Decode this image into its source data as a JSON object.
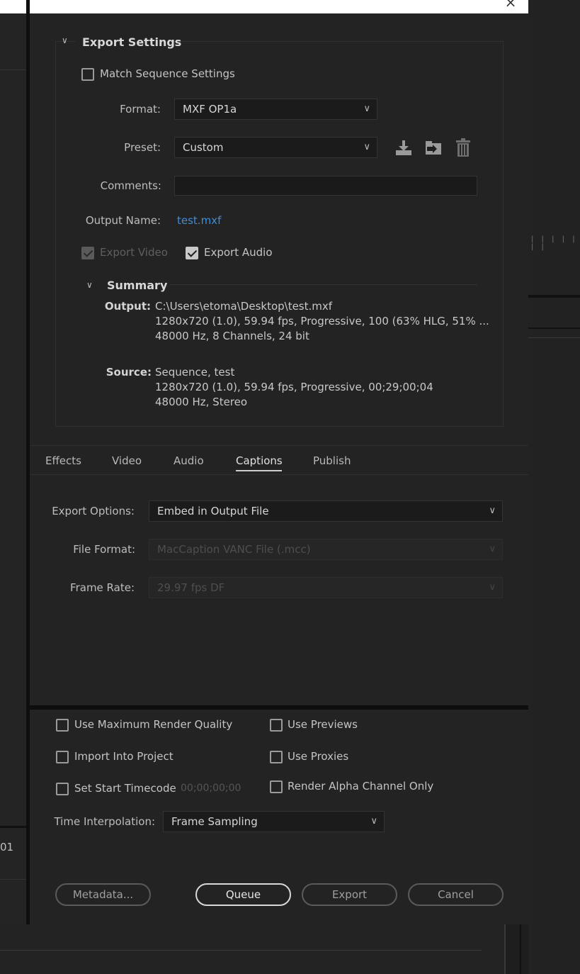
{
  "export_settings": {
    "title": "Export Settings",
    "match_sequence_label": "Match Sequence Settings",
    "format_label": "Format:",
    "format_value": "MXF OP1a",
    "preset_label": "Preset:",
    "preset_value": "Custom",
    "comments_label": "Comments:",
    "comments_value": "",
    "output_name_label": "Output Name:",
    "output_name_value": "test.mxf",
    "export_video_label": "Export Video",
    "export_audio_label": "Export Audio",
    "icons": [
      "save-preset-icon",
      "import-preset-icon",
      "delete-preset-icon"
    ]
  },
  "summary": {
    "title": "Summary",
    "output_label": "Output:",
    "output_lines": [
      "C:\\Users\\etoma\\Desktop\\test.mxf",
      "1280x720 (1.0), 59.94 fps, Progressive, 100 (63% HLG, 51% ...",
      "48000 Hz, 8 Channels, 24 bit"
    ],
    "source_label": "Source:",
    "source_lines": [
      "Sequence, test",
      "1280x720 (1.0), 59.94 fps, Progressive, 00;29;00;04",
      "48000 Hz, Stereo"
    ]
  },
  "tabs": {
    "items": [
      "Effects",
      "Video",
      "Audio",
      "Captions",
      "Publish"
    ],
    "active": "Captions"
  },
  "captions": {
    "export_options_label": "Export Options:",
    "export_options_value": "Embed in Output File",
    "file_format_label": "File Format:",
    "file_format_value": "MacCaption VANC File (.mcc)",
    "frame_rate_label": "Frame Rate:",
    "frame_rate_value": "29.97 fps DF"
  },
  "options": {
    "max_render_quality": "Use Maximum Render Quality",
    "use_previews": "Use Previews",
    "import_into_project": "Import Into Project",
    "use_proxies": "Use Proxies",
    "set_start_timecode": "Set Start Timecode",
    "start_timecode_value": "00;00;00;00",
    "render_alpha": "Render Alpha Channel Only",
    "time_interp_label": "Time Interpolation:",
    "time_interp_value": "Frame Sampling"
  },
  "buttons": {
    "metadata": "Metadata...",
    "queue": "Queue",
    "export": "Export",
    "cancel": "Cancel"
  },
  "background": {
    "left_fragment": "01",
    "close_glyph": "×"
  }
}
